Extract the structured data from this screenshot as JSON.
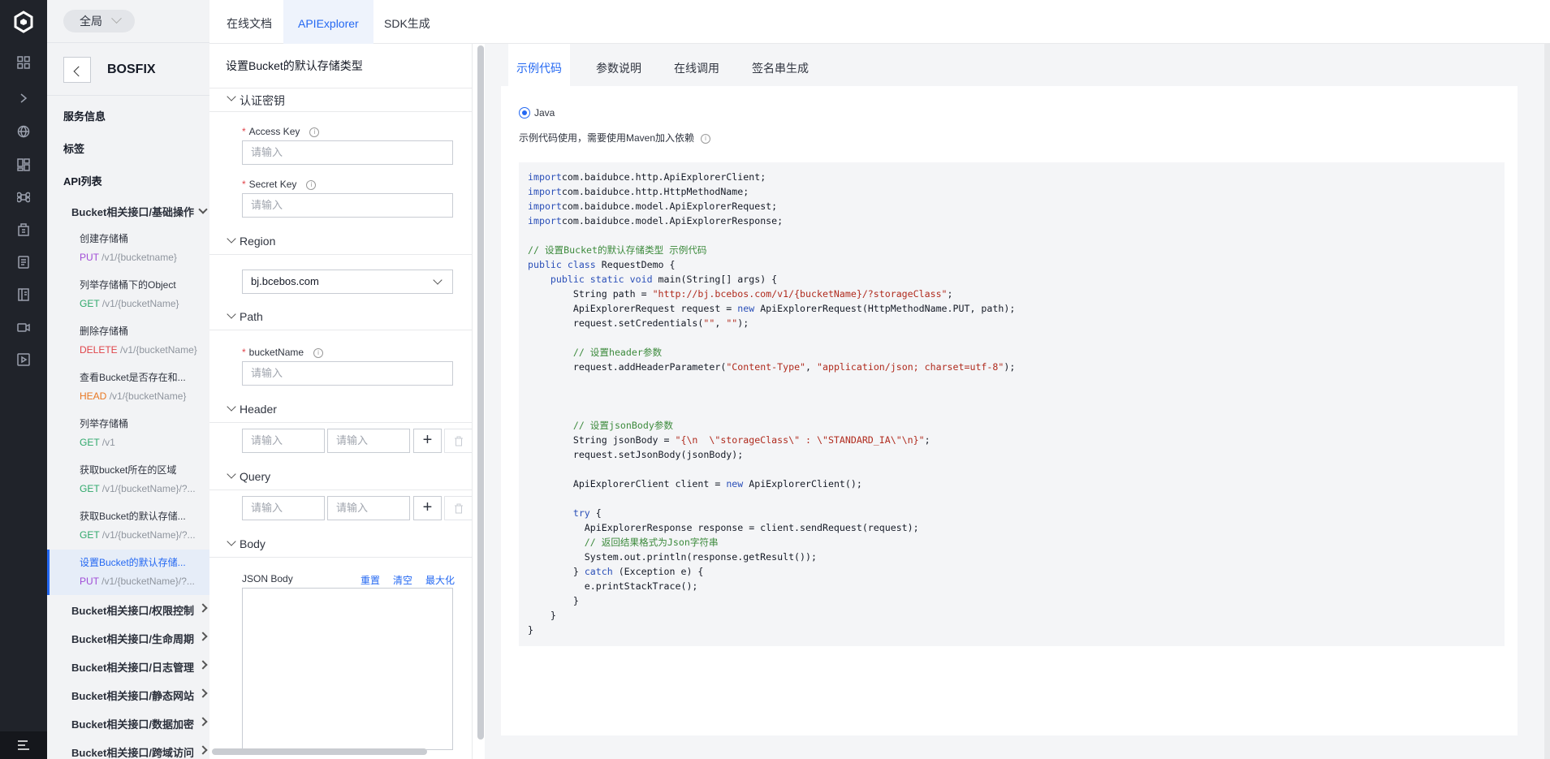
{
  "rail": {
    "icons": [
      "grid-icon",
      "expand-icon",
      "globe-icon",
      "dashboard-icon",
      "command-icon",
      "building-icon",
      "document-icon",
      "book-icon",
      "camera-icon",
      "play-icon"
    ],
    "bottom_icon": "menu-icon"
  },
  "sidebar": {
    "scope_label": "全局",
    "title": "BOSFIX",
    "sections": {
      "service_info": "服务信息",
      "tags": "标签",
      "api_list": "API列表"
    },
    "open_group": "Bucket相关接口/基础操作",
    "apis": [
      {
        "name": "创建存储桶",
        "method": "PUT",
        "path": "/v1/{bucketname}"
      },
      {
        "name": "列举存储桶下的Object",
        "method": "GET",
        "path": "/v1/{bucketName}"
      },
      {
        "name": "删除存储桶",
        "method": "DELETE",
        "path": "/v1/{bucketName}"
      },
      {
        "name": "查看Bucket是否存在和...",
        "method": "HEAD",
        "path": "/v1/{bucketName}"
      },
      {
        "name": "列举存储桶",
        "method": "GET",
        "path": "/v1"
      },
      {
        "name": "获取bucket所在的区域",
        "method": "GET",
        "path": "/v1/{bucketName}/?..."
      },
      {
        "name": "获取Bucket的默认存储...",
        "method": "GET",
        "path": "/v1/{bucketName}/?..."
      },
      {
        "name": "设置Bucket的默认存储...",
        "method": "PUT",
        "path": "/v1/{bucketName}/?..."
      }
    ],
    "groups": [
      "Bucket相关接口/权限控制",
      "Bucket相关接口/生命周期",
      "Bucket相关接口/日志管理",
      "Bucket相关接口/静态网站",
      "Bucket相关接口/数据加密",
      "Bucket相关接口/跨域访问"
    ]
  },
  "top_tabs": [
    "在线文档",
    "APIExplorer",
    "SDK生成"
  ],
  "form": {
    "title": "设置Bucket的默认存储类型",
    "auth_section": "认证密钥",
    "access_key_label": "Access Key",
    "secret_key_label": "Secret Key",
    "placeholder": "请输入",
    "region_section": "Region",
    "region_value": "bj.bcebos.com",
    "path_section": "Path",
    "bucket_label": "bucketName",
    "header_section": "Header",
    "query_section": "Query",
    "body_section": "Body",
    "json_label": "JSON Body",
    "json_actions": [
      "重置",
      "清空",
      "最大化"
    ],
    "add_symbol": "+"
  },
  "content": {
    "tabs": [
      "示例代码",
      "参数说明",
      "在线调用",
      "签名串生成"
    ],
    "language": "Java",
    "note": "示例代码使用，需要使用Maven加入依赖",
    "code_lines": [
      [
        [
          "kw",
          "import"
        ],
        [
          "",
          "com.baidubce.http.ApiExplorerClient;"
        ]
      ],
      [
        [
          "kw",
          "import"
        ],
        [
          "",
          "com.baidubce.http.HttpMethodName;"
        ]
      ],
      [
        [
          "kw",
          "import"
        ],
        [
          "",
          "com.baidubce.model.ApiExplorerRequest;"
        ]
      ],
      [
        [
          "kw",
          "import"
        ],
        [
          "",
          "com.baidubce.model.ApiExplorerResponse;"
        ]
      ],
      [],
      [
        [
          "cm",
          "// 设置Bucket的默认存储类型 示例代码"
        ]
      ],
      [
        [
          "kw",
          "public class"
        ],
        [
          "",
          " RequestDemo {"
        ]
      ],
      [
        [
          "",
          " "
        ],
        [
          "kw",
          "   public static void"
        ],
        [
          "",
          " main(String[] args) {"
        ]
      ],
      [
        [
          "",
          "        String path = "
        ],
        [
          "str",
          "\"http://bj.bcebos.com/v1/{bucketName}/?storageClass\""
        ],
        [
          "",
          ";"
        ]
      ],
      [
        [
          "",
          "        ApiExplorerRequest request = "
        ],
        [
          "kw",
          "new"
        ],
        [
          "",
          " ApiExplorerRequest(HttpMethodName.PUT, path);"
        ]
      ],
      [
        [
          "",
          "        request.setCredentials("
        ],
        [
          "str",
          "\"\""
        ],
        [
          "",
          ", "
        ],
        [
          "str",
          "\"\""
        ],
        [
          "",
          ");"
        ]
      ],
      [],
      [
        [
          "cm",
          "        // 设置header参数"
        ]
      ],
      [
        [
          "",
          "        request.addHeaderParameter("
        ],
        [
          "str",
          "\"Content-Type\""
        ],
        [
          "",
          ", "
        ],
        [
          "str",
          "\"application/json; charset=utf-8\""
        ],
        [
          "",
          ");"
        ]
      ],
      [],
      [],
      [],
      [
        [
          "cm",
          "        // 设置jsonBody参数"
        ]
      ],
      [
        [
          "",
          "        String jsonBody = "
        ],
        [
          "str",
          "\"{\\n  \\\"storageClass\\\" : \\\"STANDARD_IA\\\"\\n}\""
        ],
        [
          "",
          ";"
        ]
      ],
      [
        [
          "",
          "        request.setJsonBody(jsonBody);"
        ]
      ],
      [],
      [
        [
          "",
          "        ApiExplorerClient client = "
        ],
        [
          "kw",
          "new"
        ],
        [
          "",
          " ApiExplorerClient();"
        ]
      ],
      [],
      [
        [
          "kw",
          "        try"
        ],
        [
          "",
          " {"
        ]
      ],
      [
        [
          "",
          "          ApiExplorerResponse response = client.sendRequest(request);"
        ]
      ],
      [
        [
          "cm",
          "          // 返回结果格式为Json字符串"
        ]
      ],
      [
        [
          "",
          "          System.out.println(response.getResult());"
        ]
      ],
      [
        [
          "",
          "        } "
        ],
        [
          "kw",
          "catch"
        ],
        [
          "",
          " (Exception e) {"
        ]
      ],
      [
        [
          "",
          "          e.printStackTrace();"
        ]
      ],
      [
        [
          "",
          "        }"
        ]
      ],
      [
        [
          "",
          "    }"
        ]
      ],
      [
        [
          "",
          "}"
        ]
      ]
    ]
  },
  "colors": {
    "accent": "#2468f2",
    "rail": "#20232a",
    "sidebar": "#f2f3f5"
  }
}
